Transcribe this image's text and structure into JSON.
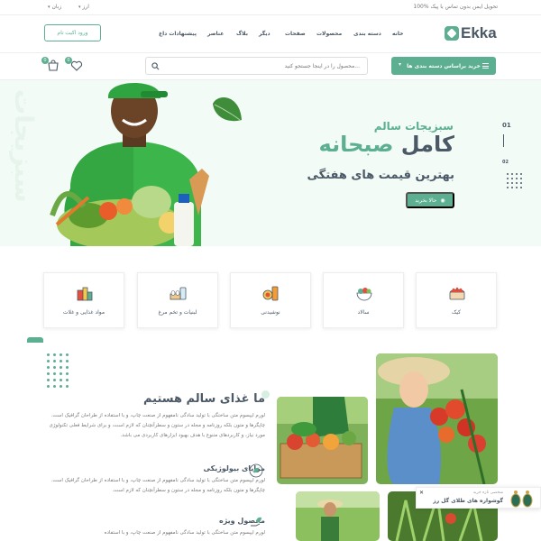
{
  "topbar": {
    "notice": "100% تحویل ایمن بدون تماس با پیک",
    "currency": "ارز",
    "language": "زبان"
  },
  "header": {
    "logo": "Ekka",
    "nav": [
      "خانه",
      "دسته بندی",
      "محصولات",
      "صفحات",
      "دیگر",
      "بلاگ",
      "عناصر",
      "پیشنهادات داغ"
    ],
    "login": "ورود اکیت تام"
  },
  "searchrow": {
    "category_button": "خرید براساس دسته بندی ها",
    "search_placeholder": "محصول را در اینجا جستجو کنید...",
    "cart_count": "0",
    "wishlist_count": "0"
  },
  "hero": {
    "kicker": "سبزیجات سالم",
    "title_main": "کامل",
    "title_highlight": "صبحانه",
    "subtitle": "بهترین قیمت های هفتگی",
    "button": "حالا بخرید",
    "slide_current": "01",
    "slide_next": "02",
    "watermark": "سبزیجات"
  },
  "categories": [
    {
      "label": "کیک",
      "icon": "cake-icon"
    },
    {
      "label": "سالاد",
      "icon": "salad-icon"
    },
    {
      "label": "نوشیدنی",
      "icon": "drink-icon"
    },
    {
      "label": "لبنیات و تخم مرغ",
      "icon": "dairy-eggs-icon"
    },
    {
      "label": "مواد غذایی و غلات",
      "icon": "groceries-icon"
    }
  ],
  "about": {
    "title": "ما غذای سالم هستیم",
    "paragraph": "لورم ایپسوم متن ساختگی با تولید سادگی نامفهوم از صنعت چاپ، و با استفاده از طراحان گرافیک است. چاپگرها و متون بلکه روزنامه و مجله در ستون و سطرآنچنان که لازم است، و برای شرایط فعلی تکنولوژی مورد نیاز، و کاربردهای متنوع با هدف بهبود ابزارهای کاربردی می باشد.",
    "features": [
      {
        "title": "مزایای بیولوژیکی",
        "text": "لورم ایپسوم متن ساختگی با تولید سادگی نامفهوم از صنعت چاپ، و با استفاده از طراحان گرافیک است. چاپگرها و متون بلکه روزنامه و مجله در ستون و سطرآنچنان که لازم است."
      },
      {
        "title": "محصول ویژه",
        "text": "لورم ایپسوم متن ساختگی با تولید سادگی نامفهوم از صنعت چاپ، و با استفاده"
      }
    ]
  },
  "toast": {
    "meta": "شخصی تازه خرید",
    "product": "گوشواره های طلای گل رز"
  },
  "colors": {
    "accent": "#5caf90",
    "text": "#4b5966",
    "hero_bg": "#f2fbf6"
  }
}
